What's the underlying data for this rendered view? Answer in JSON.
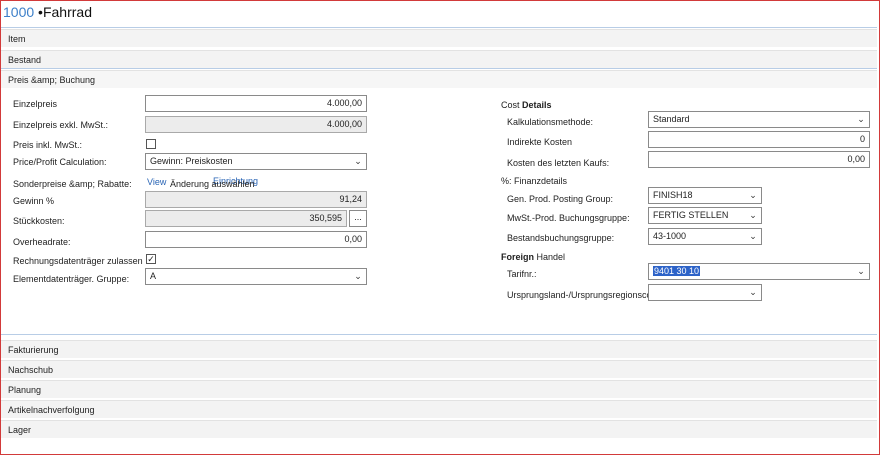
{
  "window": {
    "item_no": "1000",
    "separator": " •",
    "item_name": "Fahrrad"
  },
  "tabs": {
    "item": "Item",
    "bestand": "Bestand",
    "preis": "Preis &amp; Buchung",
    "fakturierung": "Fakturierung",
    "nachschub": "Nachschub",
    "planung": "Planung",
    "artikelnachverfolgung": "Artikelnachverfolgung",
    "lager": "Lager"
  },
  "left": {
    "einzelpreis": {
      "label": "Einzelpreis",
      "value": "4.000,00"
    },
    "einzelpreis_exkl": {
      "label": "Einzelpreis exkl. MwSt.:",
      "value": "4.000,00"
    },
    "preis_inkl": {
      "label": "Preis inkl. MwSt.:",
      "checked": ""
    },
    "price_calc": {
      "label": "Price/Profit Calculation:",
      "value": "Gewinn: Preiskosten"
    },
    "sonderpreise": {
      "label": "Sonderpreise &amp; Rabatte:",
      "link_view": "View",
      "link_einrichtung": "Einrichtung",
      "text_aenderung": "Änderung auswählen"
    },
    "gewinn": {
      "label": "Gewinn %",
      "value": "91,24"
    },
    "stueckkosten": {
      "label": "Stückkosten:",
      "value": "350,595",
      "btn": "..."
    },
    "overheadrate": {
      "label": "Overheadrate:",
      "value": "0,00"
    },
    "rechnungsdaten": {
      "label": "Rechnungsdatenträger zulassen",
      "checked": "✓"
    },
    "elementdaten": {
      "label": "Elementdatenträger. Gruppe:",
      "value": "A"
    }
  },
  "right": {
    "cost_details": {
      "prefix": "Cost",
      "title": "Details"
    },
    "kalkulationsmethode": {
      "label": "Kalkulationsmethode:",
      "value": "Standard"
    },
    "indirekte_kosten": {
      "label": "Indirekte Kosten",
      "value": "0"
    },
    "kosten_letzter_kauf": {
      "label": "Kosten des letzten Kaufs:",
      "value": "0,00"
    },
    "finanzdetails": {
      "title": "%: Finanzdetails"
    },
    "gen_prod": {
      "label": "Gen. Prod. Posting Group:",
      "value": "FINISH18"
    },
    "mwst_prod": {
      "label": "MwSt.-Prod. Buchungsgruppe:",
      "value": "FERTIG STELLEN"
    },
    "bestandsbuchung": {
      "label": "Bestandsbuchungsgruppe:",
      "value": "43-1000"
    },
    "foreign_handel": {
      "prefix": "Foreign",
      "title": "Handel"
    },
    "tarifnr": {
      "label": "Tarifnr.:",
      "value": "9401 30 10"
    },
    "ursprungsland": {
      "label": "Ursprungsland-/Ursprungsregionscode",
      "value": ""
    }
  }
}
